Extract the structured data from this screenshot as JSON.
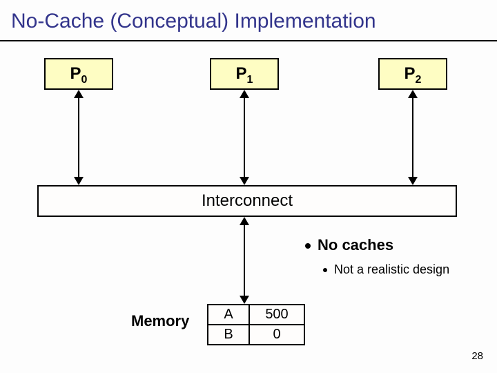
{
  "title": "No-Cache (Conceptual) Implementation",
  "processors": {
    "p0": "P",
    "p0sub": "0",
    "p1": "P",
    "p1sub": "1",
    "p2": "P",
    "p2sub": "2"
  },
  "interconnect": "Interconnect",
  "bullets": {
    "main": "No caches",
    "sub": "Not a realistic design"
  },
  "memory": {
    "label": "Memory",
    "rows": [
      {
        "key": "A",
        "val": "500"
      },
      {
        "key": "B",
        "val": "0"
      }
    ]
  },
  "page": "28"
}
